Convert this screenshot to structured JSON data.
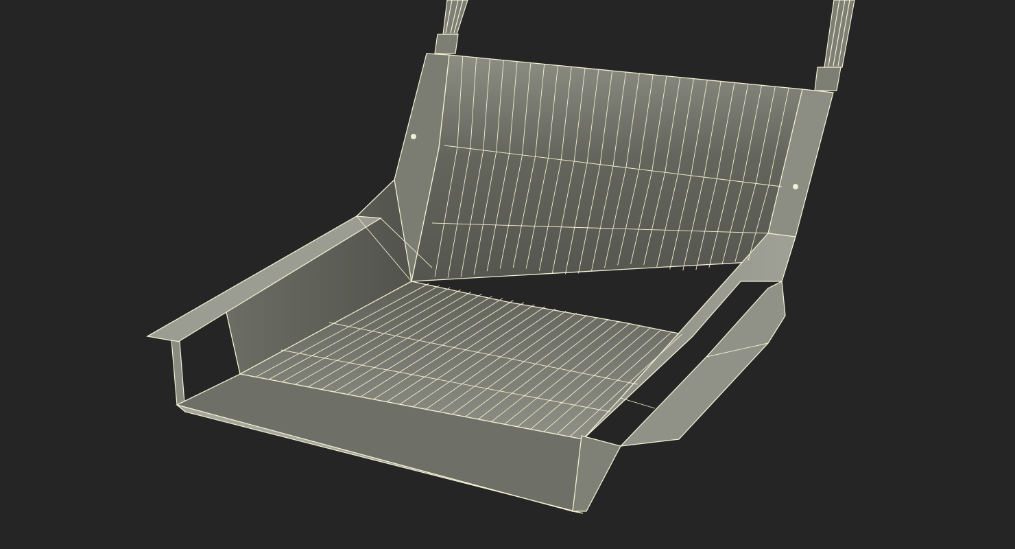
{
  "scene": {
    "subject": "wireframe-swing-seat-render",
    "colors": {
      "background": "#252525",
      "surface_light": "#8a8b80",
      "surface_mid": "#6f7066",
      "surface_dark": "#4e4f48",
      "wire": "#f2f0d4"
    }
  }
}
